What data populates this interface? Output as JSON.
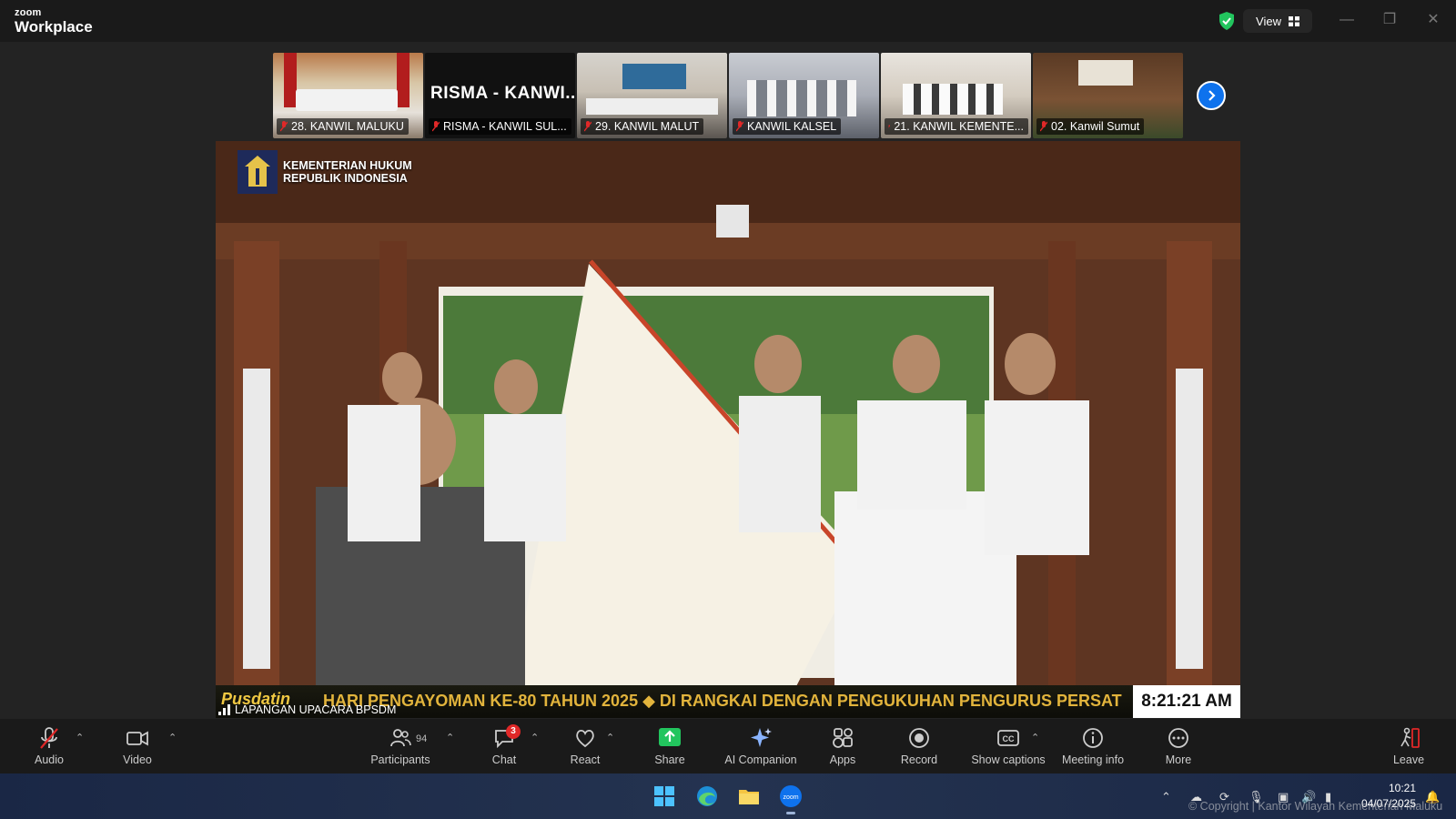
{
  "app": {
    "brand_small": "zoom",
    "brand_large": "Workplace"
  },
  "header": {
    "view_label": "View",
    "view_icon": "grid-icon",
    "security_icon": "shield-check-icon"
  },
  "gallery": {
    "tiles": [
      {
        "name": "28. KANWIL MALUKU",
        "muted": true
      },
      {
        "name": "RISMA - KANWIL SUL...",
        "muted": true,
        "big_text": "RISMA  -  KANWI..."
      },
      {
        "name": "29. KANWIL MALUT",
        "muted": true
      },
      {
        "name": "KANWIL KALSEL",
        "muted": true
      },
      {
        "name": "21. KANWIL KEMENTE...",
        "muted": true
      },
      {
        "name": "02. Kanwil Sumut",
        "muted": true
      }
    ],
    "next_icon": "chevron-right-icon"
  },
  "main_video": {
    "ministry_line1": "KEMENTERIAN HUKUM",
    "ministry_line2": "REPUBLIK INDONESIA",
    "channel": "Pusdatin",
    "ticker": "HARI PENGAYOMAN KE-80 TAHUN 2025  ◆  DI RANGKAI DENGAN PENGUKUHAN PENGURUS PERSAT",
    "clock": "8:21:21 AM",
    "venue": "LAPANGAN UPACARA BPSDM"
  },
  "toolbar": {
    "audio": "Audio",
    "video": "Video",
    "participants": "Participants",
    "participants_count": "94",
    "chat": "Chat",
    "chat_badge": "3",
    "react": "React",
    "share": "Share",
    "ai_companion": "AI Companion",
    "apps": "Apps",
    "record": "Record",
    "captions": "Show captions",
    "meeting_info": "Meeting info",
    "more": "More",
    "leave": "Leave"
  },
  "taskbar": {
    "time": "10:21",
    "date": "04/07/2025",
    "copyright": "© Copyright | Kantor Wilayah Kementerian Maluku"
  },
  "colors": {
    "accent": "#0e72ed",
    "share_green": "#22c55e",
    "badge_red": "#e02828",
    "ticker_gold": "#e2b43c"
  }
}
